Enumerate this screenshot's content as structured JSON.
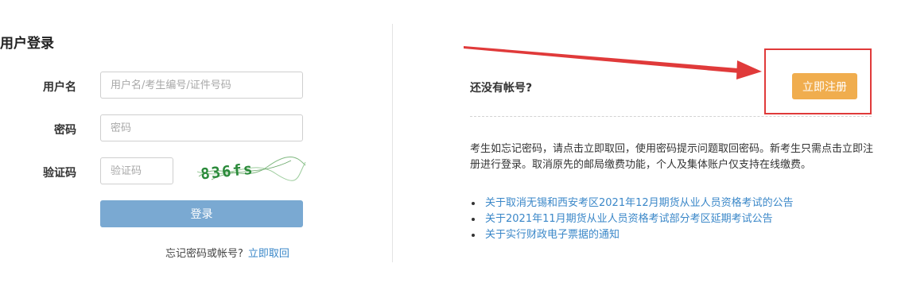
{
  "login": {
    "title": "用户登录",
    "username_label": "用户名",
    "username_placeholder": "用户名/考生编号/证件号码",
    "password_label": "密码",
    "password_placeholder": "密码",
    "captcha_label": "验证码",
    "captcha_placeholder": "验证码",
    "captcha_text": "836fs",
    "login_button": "登录",
    "forgot_text": "忘记密码或帐号?",
    "forgot_link": "立即取回"
  },
  "register": {
    "no_account_text": "还没有帐号?",
    "register_button": "立即注册",
    "description": "考生如忘记密码，请点击立即取回，使用密码提示问题取回密码。新考生只需点击立即注册进行登录。取消原先的邮局缴费功能，个人及集体账户仅支持在线缴费。",
    "notices": [
      {
        "text": "关于取消无锡和西安考区2021年12月期货从业人员资格考试的公告"
      },
      {
        "text": "关于2021年11月期货从业人员资格考试部分考区延期考试公告"
      },
      {
        "text": "关于实行财政电子票据的通知"
      }
    ]
  },
  "colors": {
    "accent_blue": "#3a87c8",
    "login_button_bg": "#7aa9d2",
    "register_button_bg": "#f0ad4e",
    "annotation_red": "#e03a3a"
  }
}
